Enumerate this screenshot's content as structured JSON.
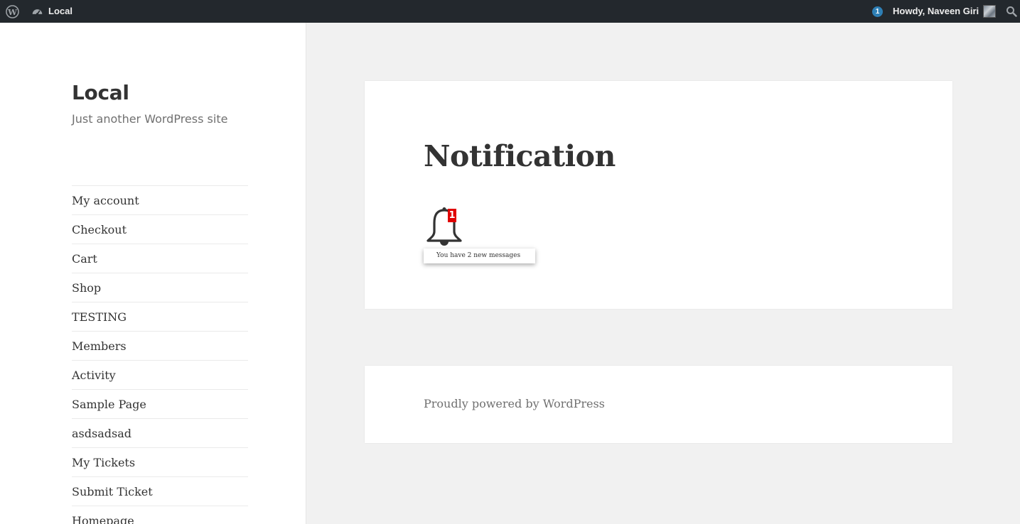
{
  "adminbar": {
    "logo_icon": "wordpress-logo-icon",
    "dashboard_icon": "dashboard-icon",
    "site_name": "Local",
    "notification_count": "1",
    "howdy": "Howdy, Naveen Giri",
    "search_icon": "search-icon",
    "bar_color": "#23282d"
  },
  "site": {
    "title": "Local",
    "description": "Just another WordPress site"
  },
  "nav": {
    "items": [
      {
        "label": "My account"
      },
      {
        "label": "Checkout"
      },
      {
        "label": "Cart"
      },
      {
        "label": "Shop"
      },
      {
        "label": "TESTING"
      },
      {
        "label": "Members"
      },
      {
        "label": "Activity"
      },
      {
        "label": "Sample Page"
      },
      {
        "label": "asdsadsad"
      },
      {
        "label": "My Tickets"
      },
      {
        "label": "Submit Ticket"
      },
      {
        "label": "Homepage"
      }
    ]
  },
  "content": {
    "title": "Notification",
    "bell_icon": "bell-icon",
    "bell_badge": "1",
    "badge_color": "#e00000",
    "popup_text": "You have 2 new messages"
  },
  "footer": {
    "text": "Proudly powered by WordPress"
  }
}
